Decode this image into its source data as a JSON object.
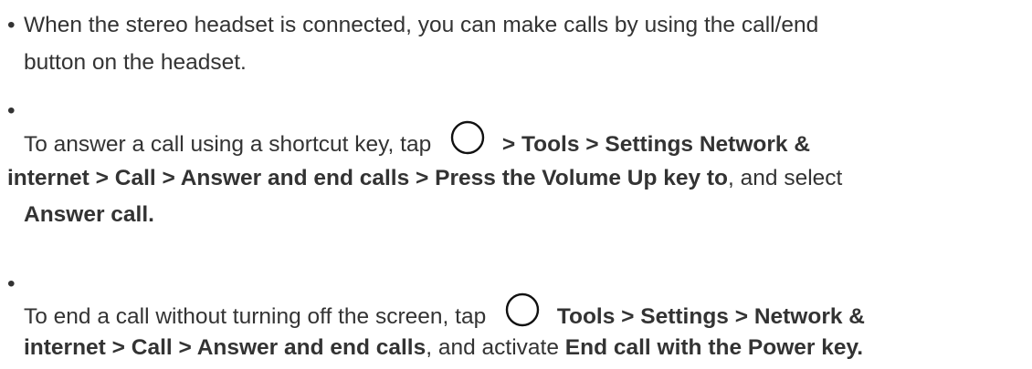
{
  "items": [
    {
      "line1": "When the stereo headset is connected, you can make calls by using the call/end",
      "line2": "button on the headset."
    },
    {
      "pre": "To answer a call using a shortcut key, tap",
      "path_bold_1": "> Tools > Settings Network &",
      "path_bold_2": "internet > Call > Answer and end calls > Press the Volume Up key to",
      "mid": ", and select",
      "end_bold": "Answer call.",
      "icon": "home-circle-icon"
    },
    {
      "pre": "To end a call without turning off the screen, tap",
      "path_bold_1": "Tools > Settings > Network &",
      "path_bold_2": "internet > Call > Answer and end calls",
      "mid": ", and activate",
      "end_bold": "End call with the Power key.",
      "icon": "home-circle-icon"
    }
  ],
  "bullet": "•"
}
